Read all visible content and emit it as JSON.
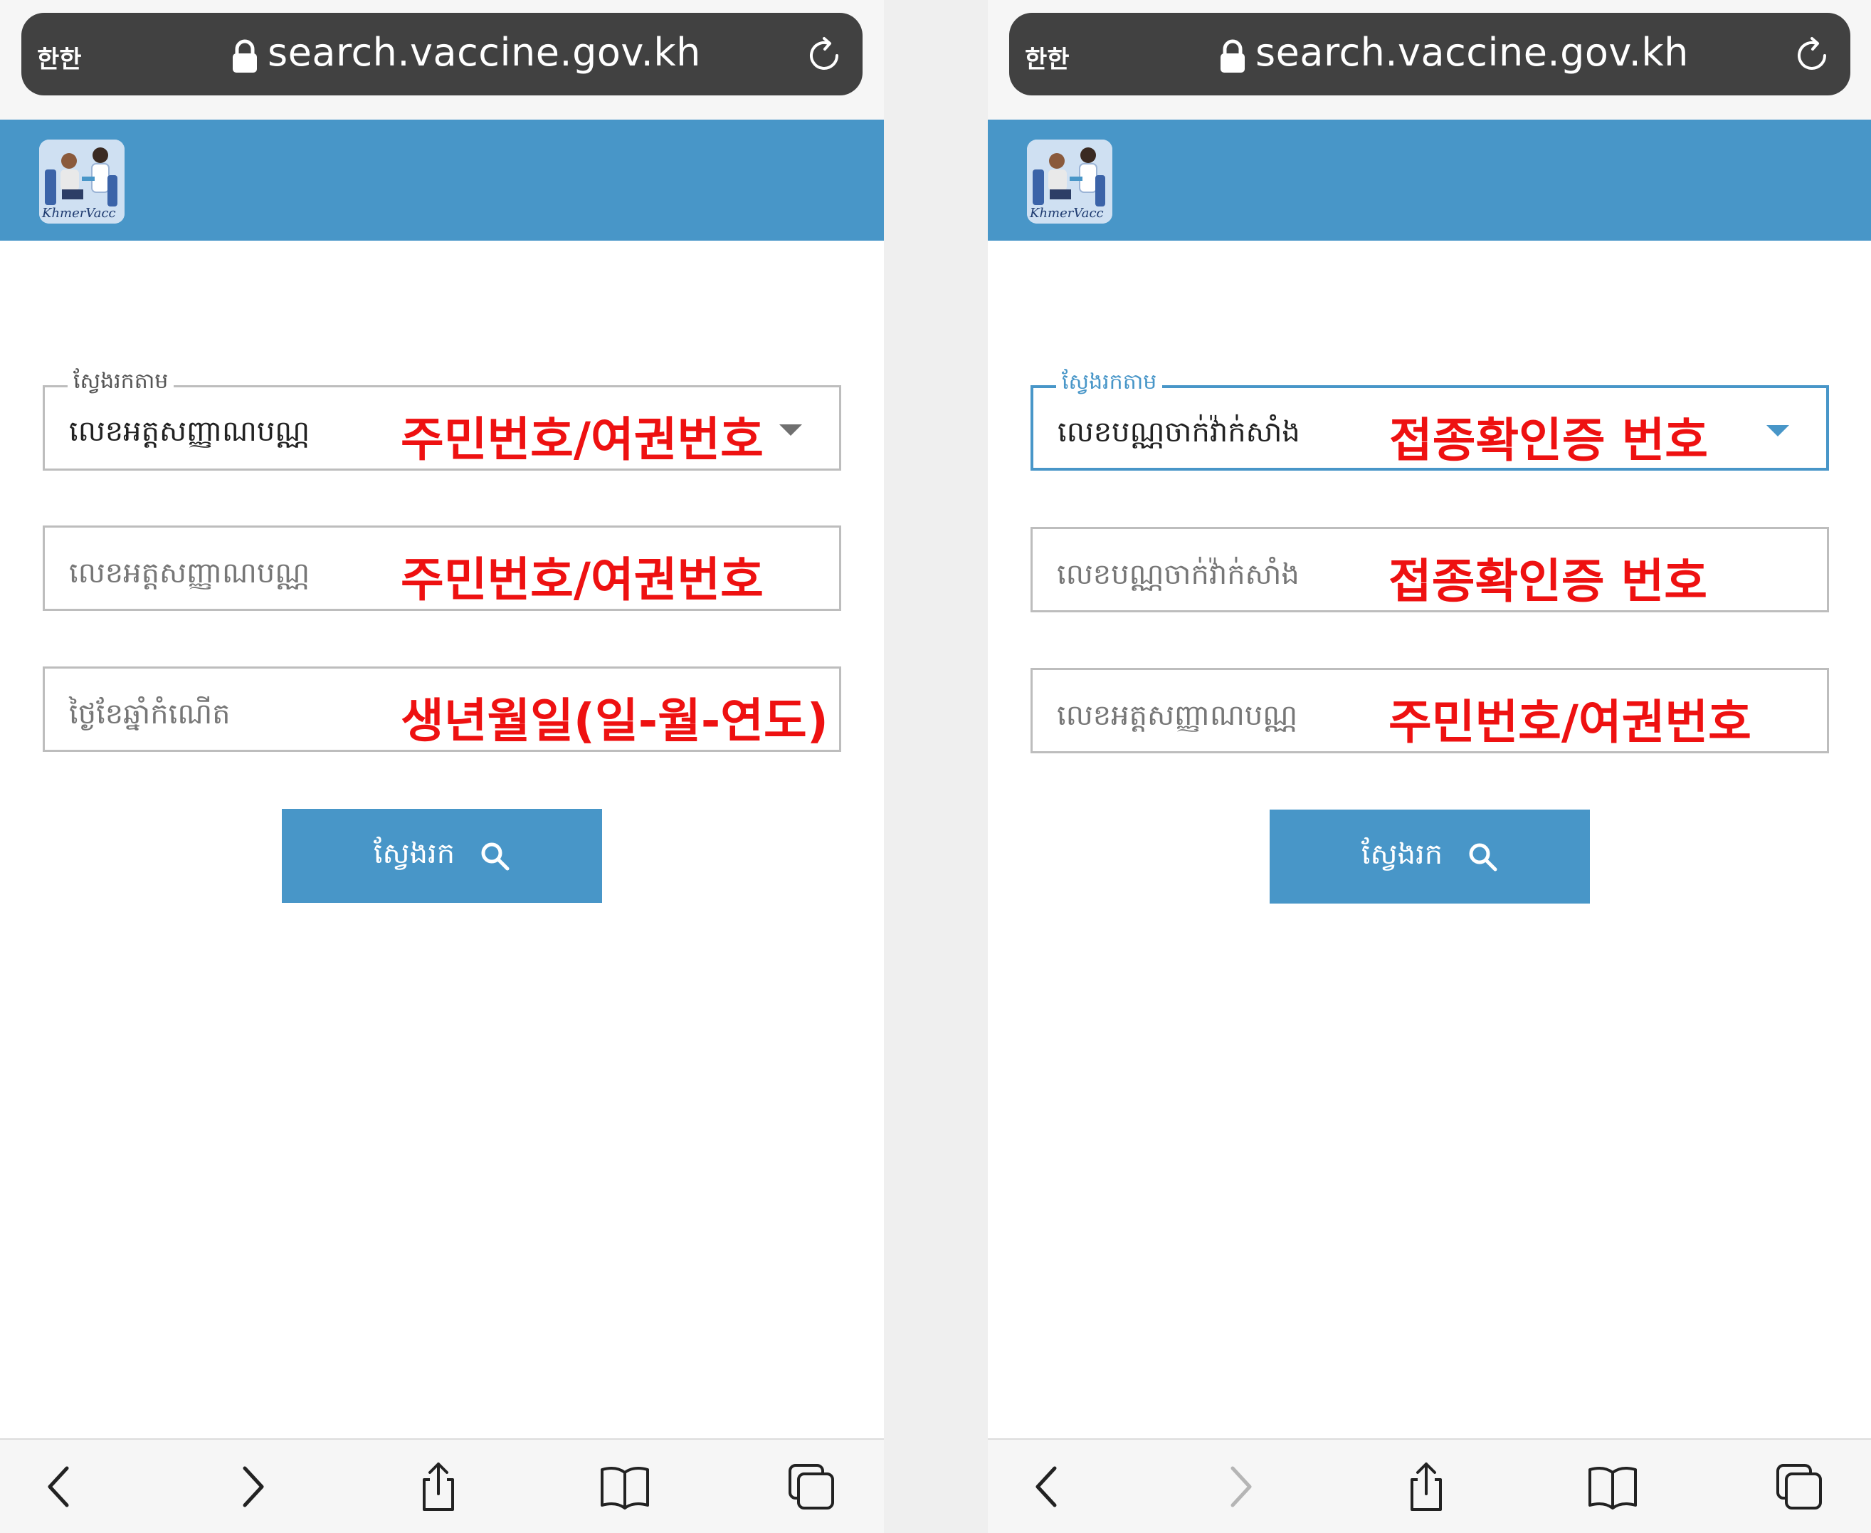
{
  "screens": [
    {
      "browser": {
        "text_size_label": "한한",
        "url": "search.vaccine.gov.kh"
      },
      "header": {
        "logo_text": "KhmerVacc"
      },
      "search_by": {
        "legend": "ស្វែងរកតាម",
        "selected": "លេខអត្តសញ្ញាណបណ្ណ",
        "annotation": "주민번호/여권번호",
        "active": false
      },
      "fields": [
        {
          "placeholder": "លេខអត្តសញ្ញាណបណ្ណ",
          "annotation": "주민번호/여권번호"
        },
        {
          "placeholder": "ថ្ងៃខែឆ្នាំកំណើត",
          "annotation": "생년월일(일-월-연도)"
        }
      ],
      "search_button": {
        "label": "ស្វែងរក",
        "icon": "search-icon"
      },
      "toolbar": {
        "back_enabled": true,
        "forward_enabled": true
      }
    },
    {
      "browser": {
        "text_size_label": "한한",
        "url": "search.vaccine.gov.kh"
      },
      "header": {
        "logo_text": "KhmerVacc"
      },
      "search_by": {
        "legend": "ស្វែងរកតាម",
        "selected": "លេខបណ្ណចាក់វ៉ាក់សាំង",
        "annotation": "접종확인증 번호",
        "active": true
      },
      "fields": [
        {
          "placeholder": "លេខបណ្ណចាក់វ៉ាក់សាំង",
          "annotation": "접종확인증 번호"
        },
        {
          "placeholder": "លេខអត្តសញ្ញាណបណ្ណ",
          "annotation": "주민번호/여권번호"
        }
      ],
      "search_button": {
        "label": "ស្វែងរក",
        "icon": "search-icon"
      },
      "toolbar": {
        "back_enabled": true,
        "forward_enabled": false
      }
    }
  ],
  "colors": {
    "accent": "#4896c8",
    "annotation": "#ee1111",
    "url_bar": "#414141"
  }
}
